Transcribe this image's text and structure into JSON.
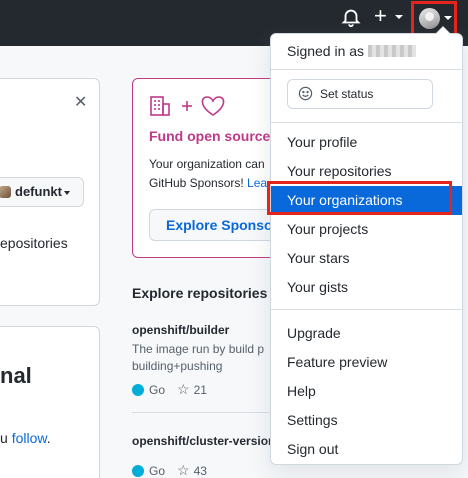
{
  "topbar": {
    "bell_icon": "bell-icon",
    "plus_glyph": "+",
    "avatar_icon": "avatar"
  },
  "left": {
    "close_glyph": "✕",
    "user_button": "defunkt",
    "repos_fragment": "epositories",
    "heading_fragment": "nal",
    "follow_prefix": "u ",
    "follow_link": "follow",
    "follow_suffix": "."
  },
  "sponsor": {
    "icons": "building-plus-heart",
    "title": "Fund open source",
    "body_line1": "Your organization can",
    "body_line2": "GitHub Sponsors! ",
    "body_link": "Lea",
    "button": "Explore Sponsors"
  },
  "explore": {
    "heading": "Explore repositories",
    "repos": [
      {
        "name": "openshift/builder",
        "desc_line1": "The image run by build p",
        "desc_line2": "building+pushing",
        "language": "Go",
        "stars": "21"
      },
      {
        "name": "openshift/cluster-version",
        "language": "Go",
        "stars": "43"
      }
    ]
  },
  "menu": {
    "signed_in_label": "Signed in as",
    "set_status": "Set status",
    "items_group1": [
      "Your profile",
      "Your repositories",
      "Your organizations",
      "Your projects",
      "Your stars",
      "Your gists"
    ],
    "items_group2": [
      "Upgrade",
      "Feature preview",
      "Help",
      "Settings",
      "Sign out"
    ],
    "active_item": "Your organizations"
  },
  "colors": {
    "header_bg": "#24292f",
    "accent_blue": "#0969da",
    "sponsor_pink": "#bf3989",
    "highlight_red": "#e5251c",
    "go_color": "#00add8"
  }
}
